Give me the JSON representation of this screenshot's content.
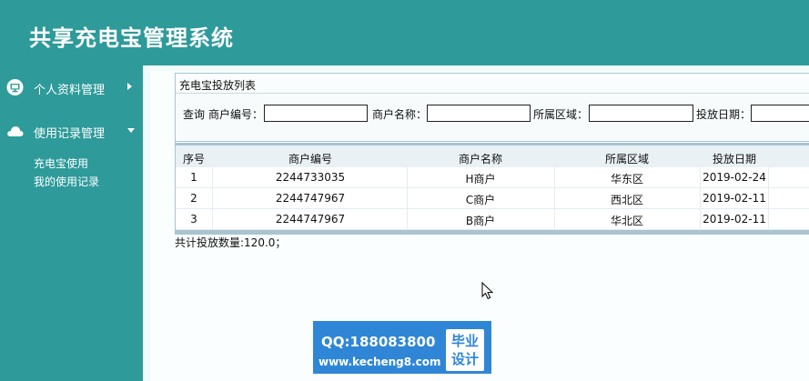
{
  "app": {
    "title": "共享充电宝管理系统"
  },
  "sidebar": {
    "groups": [
      {
        "label": "个人资料管理",
        "icon": "monitor-icon",
        "expanded": false
      },
      {
        "label": "使用记录管理",
        "icon": "cloud-icon",
        "expanded": true,
        "items": [
          "充电宝使用",
          "我的使用记录"
        ]
      }
    ]
  },
  "panel": {
    "title": "充电宝投放列表",
    "search": {
      "prefix": "查询",
      "merchant_id_label": "商户编号：",
      "merchant_id_value": "",
      "merchant_name_label": "商户名称：",
      "merchant_name_value": "",
      "region_label": "所属区域：",
      "region_value": "",
      "date_label": "投放日期：",
      "date_value": ""
    },
    "table": {
      "columns": [
        "序号",
        "商户编号",
        "商户名称",
        "所属区域",
        "投放日期"
      ],
      "rows": [
        [
          "1",
          "2244733035",
          "H商户",
          "华东区",
          "2019-02-24"
        ],
        [
          "2",
          "2244747967",
          "C商户",
          "西北区",
          "2019-02-11"
        ],
        [
          "3",
          "2244747967",
          "B商户",
          "华北区",
          "2019-02-11"
        ]
      ]
    },
    "summary": "共计投放数量:120.0；"
  },
  "watermark": {
    "qq": "QQ:188083800",
    "url": "www.kecheng8.com",
    "badge_line1": "毕业",
    "badge_line2": "设计"
  },
  "colors": {
    "header": "#2e9a9a",
    "panel_border": "#a9c4d0",
    "watermark": "#2f86d6"
  }
}
